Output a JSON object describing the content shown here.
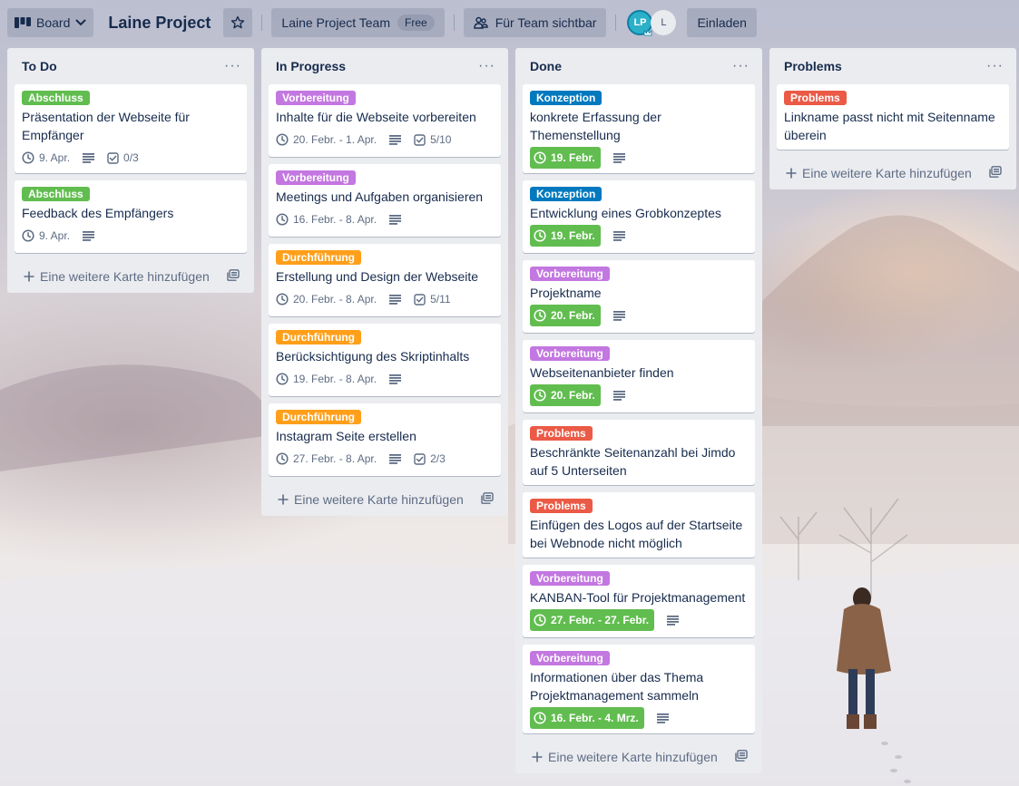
{
  "header": {
    "board_button": "Board",
    "title": "Laine Project",
    "team_button": "Laine Project Team",
    "team_badge": "Free",
    "visibility_button": "Für Team sichtbar",
    "members": [
      "LP",
      "L"
    ],
    "invite_button": "Einladen"
  },
  "lists": [
    {
      "title": "To Do",
      "menu": "···",
      "add_card": "Eine weitere Karte hinzufügen",
      "cards": [
        {
          "label": "Abschluss",
          "label_color": "#61bd4f",
          "title": "Präsentation der Webseite für Empfänger",
          "due": "9. Apr.",
          "due_done": false,
          "description": true,
          "checklist": "0/3"
        },
        {
          "label": "Abschluss",
          "label_color": "#61bd4f",
          "title": "Feedback des Empfängers",
          "due": "9. Apr.",
          "due_done": false,
          "description": true,
          "checklist": ""
        }
      ]
    },
    {
      "title": "In Progress",
      "menu": "···",
      "add_card": "Eine weitere Karte hinzufügen",
      "cards": [
        {
          "label": "Vorbereitung",
          "label_color": "#c377e0",
          "title": "Inhalte für die Webseite vorbereiten",
          "due": "20. Febr. - 1. Apr.",
          "due_done": false,
          "description": true,
          "checklist": "5/10"
        },
        {
          "label": "Vorbereitung",
          "label_color": "#c377e0",
          "title": "Meetings und Aufgaben organisieren",
          "due": "16. Febr. - 8. Apr.",
          "due_done": false,
          "description": true,
          "checklist": ""
        },
        {
          "label": "Durchführung",
          "label_color": "#ff9f1a",
          "title": "Erstellung und Design der Webseite",
          "due": "20. Febr. - 8. Apr.",
          "due_done": false,
          "description": true,
          "checklist": "5/11"
        },
        {
          "label": "Durchführung",
          "label_color": "#ff9f1a",
          "title": "Berücksichtigung des Skriptinhalts",
          "due": "19. Febr. - 8. Apr.",
          "due_done": false,
          "description": true,
          "checklist": ""
        },
        {
          "label": "Durchführung",
          "label_color": "#ff9f1a",
          "title": "Instagram Seite erstellen",
          "due": "27. Febr. - 8. Apr.",
          "due_done": false,
          "description": true,
          "checklist": "2/3"
        }
      ]
    },
    {
      "title": "Done",
      "menu": "···",
      "add_card": "Eine weitere Karte hinzufügen",
      "cards": [
        {
          "label": "Konzeption",
          "label_color": "#0079bf",
          "title": "konkrete Erfassung der Themenstellung",
          "due": "19. Febr.",
          "due_done": true,
          "description": true,
          "checklist": ""
        },
        {
          "label": "Konzeption",
          "label_color": "#0079bf",
          "title": "Entwicklung eines Grobkonzeptes",
          "due": "19. Febr.",
          "due_done": true,
          "description": true,
          "checklist": ""
        },
        {
          "label": "Vorbereitung",
          "label_color": "#c377e0",
          "title": "Projektname",
          "due": "20. Febr.",
          "due_done": true,
          "description": true,
          "checklist": ""
        },
        {
          "label": "Vorbereitung",
          "label_color": "#c377e0",
          "title": "Webseitenanbieter finden",
          "due": "20. Febr.",
          "due_done": true,
          "description": true,
          "checklist": ""
        },
        {
          "label": "Problems",
          "label_color": "#eb5a46",
          "title": "Beschränkte Seitenanzahl bei Jimdo auf 5 Unterseiten",
          "due": "",
          "due_done": false,
          "description": false,
          "checklist": ""
        },
        {
          "label": "Problems",
          "label_color": "#eb5a46",
          "title": "Einfügen des Logos auf der Startseite bei Webnode nicht möglich",
          "due": "",
          "due_done": false,
          "description": false,
          "checklist": ""
        },
        {
          "label": "Vorbereitung",
          "label_color": "#c377e0",
          "title": "KANBAN-Tool für Projektmanagement",
          "due": "27. Febr. - 27. Febr.",
          "due_done": true,
          "description": true,
          "checklist": ""
        },
        {
          "label": "Vorbereitung",
          "label_color": "#c377e0",
          "title": "Informationen über das Thema Projektmanagement sammeln",
          "due": "16. Febr. - 4. Mrz.",
          "due_done": true,
          "description": true,
          "checklist": ""
        }
      ]
    },
    {
      "title": "Problems",
      "menu": "···",
      "add_card": "Eine weitere Karte hinzufügen",
      "cards": [
        {
          "label": "Problems",
          "label_color": "#eb5a46",
          "title": "Linkname passt nicht mit Seitenname überein",
          "due": "",
          "due_done": false,
          "description": false,
          "checklist": ""
        }
      ]
    }
  ],
  "icons": {
    "board": "board-icon",
    "chevron": "chevron-down-icon",
    "star": "star-icon",
    "visibility": "team-visibility-icon",
    "clock": "clock-icon",
    "description": "description-icon",
    "checklist": "checklist-icon",
    "template": "card-template-icon",
    "plus": "plus-icon"
  }
}
